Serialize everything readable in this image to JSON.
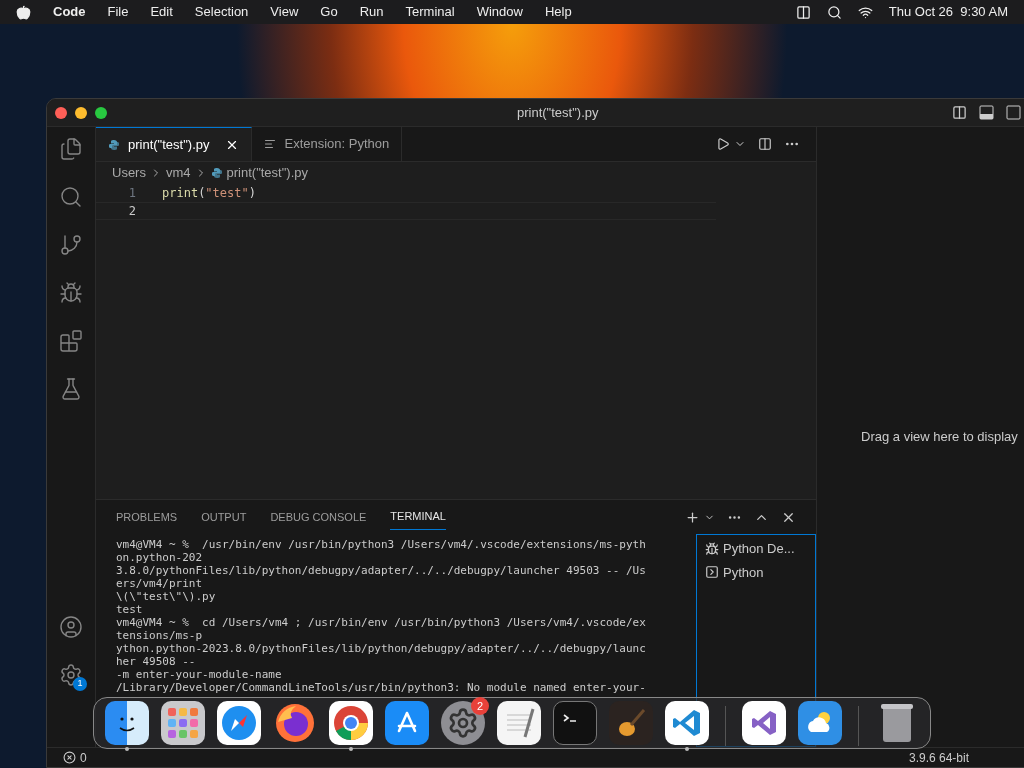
{
  "menubar": {
    "app": "Code",
    "items": [
      "File",
      "Edit",
      "Selection",
      "View",
      "Go",
      "Run",
      "Terminal",
      "Window",
      "Help"
    ],
    "clock": "Thu Oct 26  9:30 AM"
  },
  "window": {
    "title": "print(\"test\").py"
  },
  "tabs": [
    {
      "label": "print(\"test\").py",
      "kind": "python",
      "selected": true
    },
    {
      "label": "Extension: Python",
      "kind": "preview",
      "selected": false
    }
  ],
  "breadcrumbs": [
    {
      "label": "Users",
      "kind": "folder"
    },
    {
      "label": "vm4",
      "kind": "folder"
    },
    {
      "label": "print(\"test\").py",
      "kind": "python"
    }
  ],
  "editor": {
    "lines": [
      {
        "number": "1",
        "current": false,
        "tokens": [
          {
            "text": "print",
            "kind": "function"
          },
          {
            "text": "(",
            "kind": "punct"
          },
          {
            "text": "\"test\"",
            "kind": "string"
          },
          {
            "text": ")",
            "kind": "punct"
          }
        ]
      },
      {
        "number": "2",
        "current": true
      }
    ]
  },
  "panel": {
    "tabs": [
      {
        "label": "PROBLEMS",
        "selected": false
      },
      {
        "label": "OUTPUT",
        "selected": false
      },
      {
        "label": "DEBUG CONSOLE",
        "selected": false
      },
      {
        "label": "TERMINAL",
        "selected": true
      }
    ],
    "terminal": [
      "vm4@VM4 ~ %  /usr/bin/env /usr/bin/python3 /Users/vm4/.vscode/extensions/ms-pyth",
      "on.python-202",
      "3.8.0/pythonFiles/lib/python/debugpy/adapter/../../debugpy/launcher 49503 -- /Us",
      "ers/vm4/print",
      "\\(\\\"test\\\"\\).py",
      "test",
      "vm4@VM4 ~ %  cd /Users/vm4 ; /usr/bin/env /usr/bin/python3 /Users/vm4/.vscode/ex",
      "tensions/ms-p",
      "ython.python-2023.8.0/pythonFiles/lib/python/debugpy/adapter/../../debugpy/launc",
      "her 49508 --",
      "-m enter-your-module-name",
      "/Library/Developer/CommandLineTools/usr/bin/python3: No module named enter-your-"
    ],
    "sessions": [
      {
        "label": "Python De...",
        "kind": "debug"
      },
      {
        "label": "Python",
        "kind": "shell"
      }
    ]
  },
  "secondary_sidebar": {
    "hint": "Drag a view here to display"
  },
  "settings_badge": "1",
  "status_bar": {
    "problems": "0",
    "interpreter": "3.9.6 64-bit"
  },
  "dock": [
    {
      "kind": "finder",
      "running": true
    },
    {
      "kind": "launchpad",
      "running": false
    },
    {
      "kind": "safari",
      "running": false
    },
    {
      "kind": "firefox",
      "running": false
    },
    {
      "kind": "chrome",
      "running": true
    },
    {
      "kind": "appstore",
      "running": false
    },
    {
      "kind": "settings",
      "running": false,
      "badge": "2"
    },
    {
      "kind": "textedit",
      "running": false
    },
    {
      "kind": "terminal",
      "running": false
    },
    {
      "kind": "garageband",
      "running": false
    },
    {
      "kind": "vscode",
      "running": true
    },
    {
      "kind": "divider"
    },
    {
      "kind": "visualstudio",
      "running": false
    },
    {
      "kind": "weather",
      "running": false
    },
    {
      "kind": "divider"
    },
    {
      "kind": "trash",
      "running": false
    }
  ]
}
